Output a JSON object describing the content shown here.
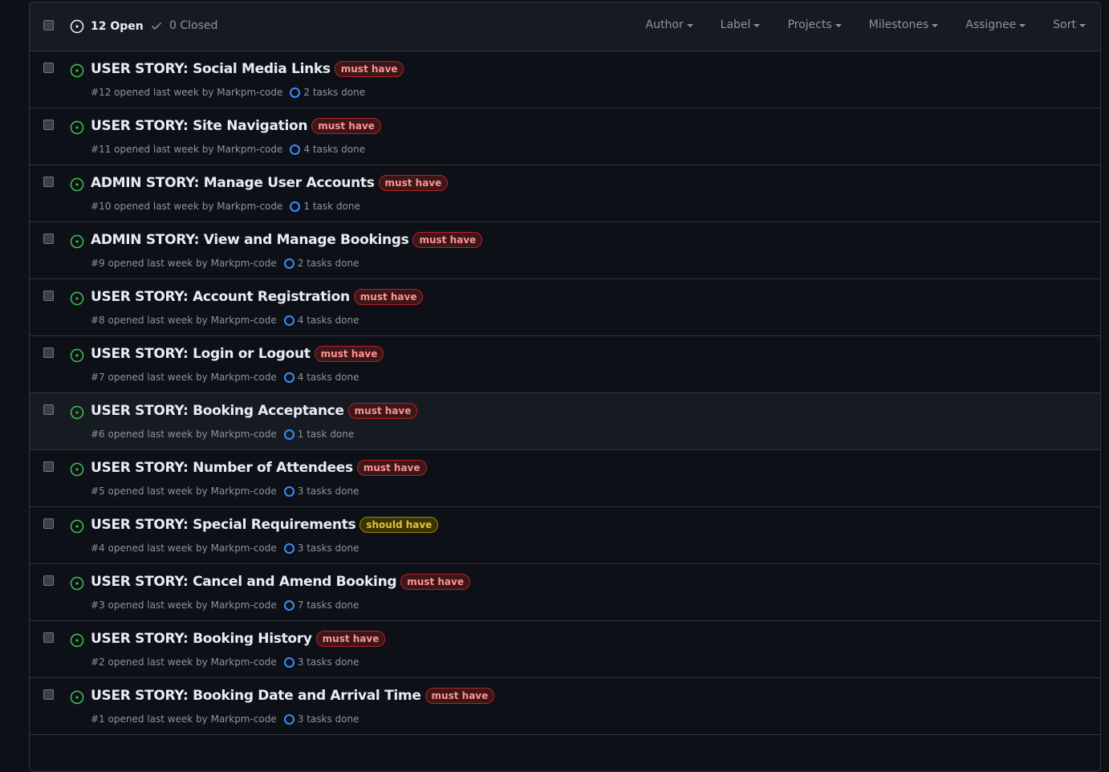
{
  "header": {
    "open_label": "12 Open",
    "closed_label": "0 Closed",
    "filters": [
      "Author",
      "Label",
      "Projects",
      "Milestones",
      "Assignee",
      "Sort"
    ]
  },
  "issues": [
    {
      "title": "USER STORY: Social Media Links",
      "label": "must have",
      "meta": "#12 opened last week by Markpm-code",
      "tasks": "2 tasks done"
    },
    {
      "title": "USER STORY: Site Navigation",
      "label": "must have",
      "meta": "#11 opened last week by Markpm-code",
      "tasks": "4 tasks done"
    },
    {
      "title": "ADMIN STORY: Manage User Accounts",
      "label": "must have",
      "meta": "#10 opened last week by Markpm-code",
      "tasks": "1 task done"
    },
    {
      "title": "ADMIN STORY: View and Manage Bookings",
      "label": "must have",
      "meta": "#9 opened last week by Markpm-code",
      "tasks": "2 tasks done"
    },
    {
      "title": "USER STORY: Account Registration",
      "label": "must have",
      "meta": "#8 opened last week by Markpm-code",
      "tasks": "4 tasks done"
    },
    {
      "title": "USER STORY: Login or Logout",
      "label": "must have",
      "meta": "#7 opened last week by Markpm-code",
      "tasks": "4 tasks done"
    },
    {
      "title": "USER STORY: Booking Acceptance",
      "label": "must have",
      "meta": "#6 opened last week by Markpm-code",
      "tasks": "1 task done"
    },
    {
      "title": "USER STORY: Number of Attendees",
      "label": "must have",
      "meta": "#5 opened last week by Markpm-code",
      "tasks": "3 tasks done"
    },
    {
      "title": "USER STORY: Special Requirements",
      "label": "should have",
      "meta": "#4 opened last week by Markpm-code",
      "tasks": "3 tasks done"
    },
    {
      "title": "USER STORY: Cancel and Amend Booking",
      "label": "must have",
      "meta": "#3 opened last week by Markpm-code",
      "tasks": "7 tasks done"
    },
    {
      "title": "USER STORY: Booking History",
      "label": "must have",
      "meta": "#2 opened last week by Markpm-code",
      "tasks": "3 tasks done"
    },
    {
      "title": "USER STORY: Booking Date and Arrival Time",
      "label": "must have",
      "meta": "#1 opened last week by Markpm-code",
      "tasks": "3 tasks done"
    }
  ],
  "colors": {
    "open_icon": "#3fb950",
    "must_have": "#ff9492",
    "should_have": "#e3c341",
    "task_ring": "#388bfd"
  }
}
